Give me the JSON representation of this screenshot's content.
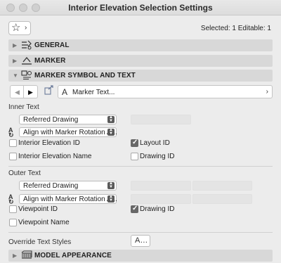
{
  "window": {
    "title": "Interior Elevation Selection Settings"
  },
  "toolbar": {
    "favorites_icon": "star-icon",
    "favorites_chevron": "›",
    "selected_info": "Selected: 1 Editable: 1"
  },
  "panels": {
    "general": {
      "label": "GENERAL",
      "icon": "general-settings-icon",
      "expanded": false
    },
    "marker": {
      "label": "MARKER",
      "icon": "marker-icon",
      "expanded": false
    },
    "marker_symbol": {
      "label": "MARKER SYMBOL AND TEXT",
      "icon": "marker-symbol-icon",
      "expanded": true
    },
    "model_appearance": {
      "label": "MODEL APPEARANCE",
      "icon": "model-appearance-icon",
      "expanded": false
    }
  },
  "nav": {
    "prev": "◀",
    "next": "▶",
    "page_label": "Marker Text...",
    "font_glyph": "A",
    "chevron": "›"
  },
  "inner_text": {
    "heading": "Inner Text",
    "drawing_select": "Referred Drawing",
    "align_select": "Align with Marker Rotation A...",
    "checkboxes": {
      "interior_elevation_id": {
        "label": "Interior Elevation ID",
        "checked": false
      },
      "layout_id": {
        "label": "Layout ID",
        "checked": true
      },
      "interior_elevation_name": {
        "label": "Interior Elevation Name",
        "checked": false
      },
      "drawing_id": {
        "label": "Drawing ID",
        "checked": false
      }
    }
  },
  "outer_text": {
    "heading": "Outer Text",
    "drawing_select": "Referred Drawing",
    "align_select": "Align with Marker Rotation A...",
    "checkboxes": {
      "viewpoint_id": {
        "label": "Viewpoint ID",
        "checked": false
      },
      "drawing_id": {
        "label": "Drawing ID",
        "checked": true
      },
      "viewpoint_name": {
        "label": "Viewpoint Name",
        "checked": false
      }
    }
  },
  "override": {
    "label": "Override Text Styles",
    "button_glyph": "A…"
  },
  "colors": {
    "panel_bg": "#d8d8d8",
    "window_bg": "#ececec",
    "checkbox_on": "#676767"
  }
}
